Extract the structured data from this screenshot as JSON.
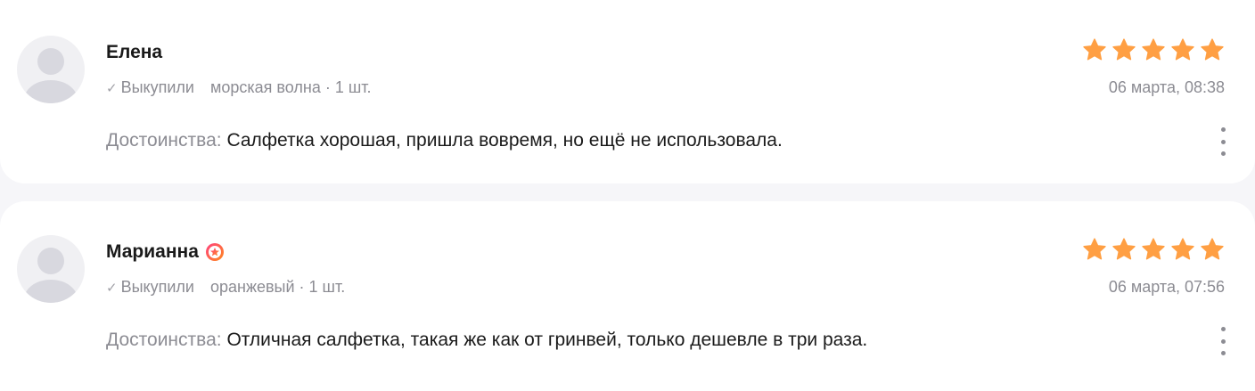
{
  "colors": {
    "star": "#ff9f43",
    "badge_gradient_start": "#ff3f7f",
    "badge_gradient_end": "#ff8a1c",
    "muted_text": "#8c8c93",
    "primary_text": "#1a1a1a"
  },
  "reviews": [
    {
      "author": "Елена",
      "has_badge": false,
      "purchase_status": "Выкупили",
      "variant": "морская волна · 1 шт.",
      "rating": 5,
      "date": "06 марта, 08:38",
      "pros_label": "Достоинства:",
      "pros_text": "Салфетка хорошая, пришла вовремя, но ещё не использовала.",
      "menu_icon": "more-vertical-icon"
    },
    {
      "author": "Марианна",
      "has_badge": true,
      "badge_icon": "star-badge-icon",
      "purchase_status": "Выкупили",
      "variant": "оранжевый · 1 шт.",
      "rating": 5,
      "date": "06 марта, 07:56",
      "pros_label": "Достоинства:",
      "pros_text": "Отличная салфетка, такая же как от гринвей, только дешевле в три раза.",
      "menu_icon": "more-vertical-icon"
    }
  ]
}
